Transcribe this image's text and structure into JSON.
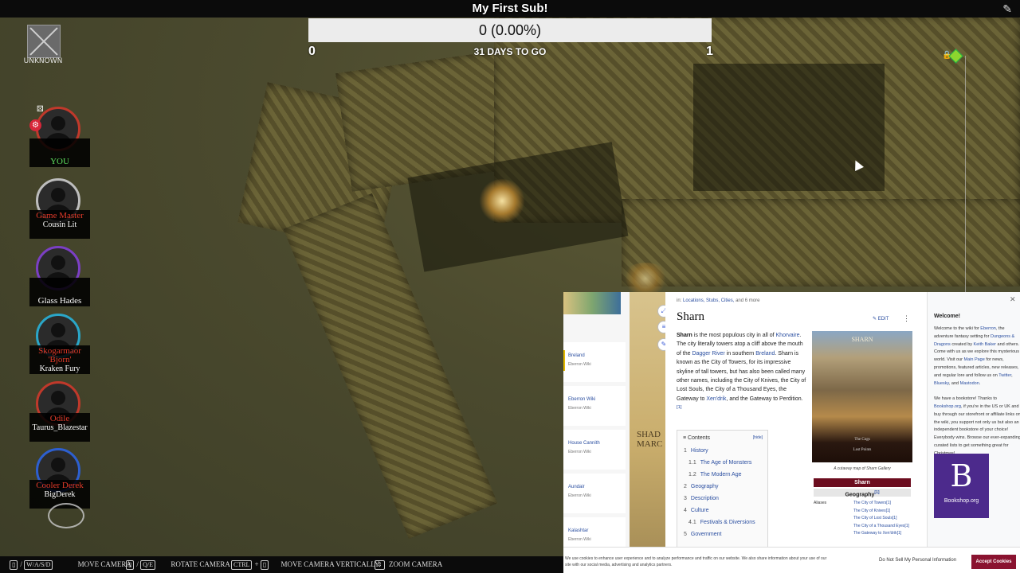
{
  "title": "My First Sub!",
  "progress": {
    "text": "0 (0.00%)",
    "fraction": 0.0,
    "min_label": "0",
    "max_label": "1",
    "days_label": "31 DAYS TO GO"
  },
  "unknown": {
    "label": "UNKNOWN"
  },
  "players": [
    {
      "line1": "",
      "line2": "YOU",
      "ring": "#c0392b"
    },
    {
      "line1": "Game Master",
      "line2": "Cousin Lit",
      "ring": "#bdbdbd"
    },
    {
      "line1": "",
      "line2": "Glass Hades",
      "ring": "#7b3fc4"
    },
    {
      "line1": "Skogarmaor 'Bjorn'",
      "line2": "Kraken Fury",
      "ring": "#2aa6c8"
    },
    {
      "line1": "Odile",
      "line2": "Taurus_Blazestar",
      "ring": "#c0392b"
    },
    {
      "line1": "Cooler Derek",
      "line2": "BigDerek",
      "ring": "#2d5fd0"
    }
  ],
  "controls": [
    {
      "keys": "W/A/S/D",
      "label": "MOVE CAMERA"
    },
    {
      "keys": "Q/E",
      "label": "ROTATE CAMERA"
    },
    {
      "keys": "CTRL",
      "label": "MOVE CAMERA VERTICALLY"
    },
    {
      "keys": "",
      "label": "ZOOM CAMERA"
    }
  ],
  "wiki": {
    "breadcrumb_prefix": "in:",
    "breadcrumb_links": "Locations, Stubs, Cities,",
    "breadcrumb_more": "and 6 more",
    "title": "Sharn",
    "edit": "EDIT",
    "sidebar_cards": [
      {
        "title": "Breland",
        "sub": "Eberron Wiki"
      },
      {
        "title": "Eberron Wiki",
        "sub": "Eberron Wiki"
      },
      {
        "title": "House Cannith",
        "sub": "Eberron Wiki"
      },
      {
        "title": "Aundair",
        "sub": "Eberron Wiki"
      },
      {
        "title": "Kalashtar",
        "sub": "Eberron Wiki"
      }
    ],
    "map_text": "SHAD MARC",
    "intro": {
      "lead": "Sharn",
      "p1": " is the most populous city in all of ",
      "l1": "Khorvaire",
      "p2": ". The city literally towers atop a cliff above the mouth of the ",
      "l2": "Dagger River",
      "p3": " in southern ",
      "l3": "Breland",
      "p4": ". Sharn is known as the City of Towers, for its impressive skyline of tall towers, but has also been called many other names, including the City of Knives, the City of Lost Souls, the City of a Thousand Eyes, the Gateway to ",
      "l4": "Xen'drik",
      "p5": ", and the Gateway to Perdition.",
      "ref": "[1]"
    },
    "toc": {
      "title": "Contents",
      "hide": "[hide]",
      "items": [
        {
          "n": "1",
          "t": "History",
          "indent": false
        },
        {
          "n": "1.1",
          "t": "The Age of Monsters",
          "indent": true
        },
        {
          "n": "1.2",
          "t": "The Modern Age",
          "indent": true
        },
        {
          "n": "2",
          "t": "Geography",
          "indent": false
        },
        {
          "n": "3",
          "t": "Description",
          "indent": false
        },
        {
          "n": "4",
          "t": "Culture",
          "indent": false
        },
        {
          "n": "4.1",
          "t": "Festivals & Diversions",
          "indent": true
        },
        {
          "n": "5",
          "t": "Government",
          "indent": false
        }
      ]
    },
    "infobox": {
      "img_title": "SHARN",
      "img_sub1": "The Cogs",
      "img_sub2": "Lost Points",
      "caption": "A cutaway map of Sharn Gallery",
      "head": "Sharn",
      "geo": "Geography",
      "geo_ref": "[1]",
      "aliases_label": "Aliases",
      "aliases": [
        "The City of Towers[1]",
        "The City of Knives[1]",
        "The City of Lost Souls[1]",
        "The City of a Thousand Eyes[1]",
        "The Gateway to Xen'drik[1]"
      ]
    },
    "welcome": {
      "title": "Welcome!",
      "text1": "Welcome to the wiki for ",
      "l1": "Eberron",
      "text2": ", the adventure fantasy setting for ",
      "l2": "Dungeons & Dragons",
      "text3": " created by ",
      "l3": "Keith Baker",
      "text4": " and others. Come with us as we explore this mysterious world. Visit our ",
      "l4": "Main Page",
      "text5": " for news, promotions, featured articles, new releases, and regular lore and follow us on ",
      "l5": "Twitter",
      "text6": ", ",
      "l6": "Bluesky",
      "text7": ", and ",
      "l7": "Mastodon",
      "text8": ".",
      "text9": "We have a bookstore! Thanks to ",
      "l8": "Bookshop.org",
      "text10": ", if you're in the US or UK and buy through our storefront or affiliate links on the wiki, you support not only us but also an independent bookstore of your choice! Everybody wins. Browse our ever-expanding curated lists to get something great for Christmas!"
    },
    "bookshop_label": "Bookshop.org"
  },
  "cookie": {
    "text": "We use cookies to enhance user experience and to analyze performance and traffic on our website. We also share information about your use of our site with our social media, advertising and analytics partners.",
    "no_sell": "Do Not Sell My Personal Information",
    "accept": "Accept Cookies"
  },
  "colors": {
    "progress_bg": "#ececec",
    "accent_red": "#e23a2a",
    "waypoint": "#8dd62e",
    "accept_btn": "#8a1330",
    "infobox_head": "#6c0d1f"
  }
}
